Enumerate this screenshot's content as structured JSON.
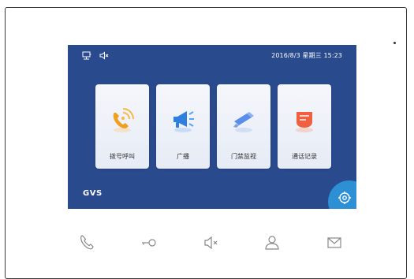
{
  "status": {
    "datetime": "2016/8/3  星期三  15:23",
    "icons": [
      "network-icon",
      "mute-icon"
    ]
  },
  "tiles": [
    {
      "label": "拨号呼叫",
      "icon": "phone-call-icon"
    },
    {
      "label": "广播",
      "icon": "megaphone-icon"
    },
    {
      "label": "门禁监视",
      "icon": "camera-icon"
    },
    {
      "label": "通话记录",
      "icon": "call-log-icon"
    }
  ],
  "brand": "GVS",
  "bottom_buttons": [
    "phone-icon",
    "key-icon",
    "speaker-mute-icon",
    "user-icon",
    "mail-icon"
  ],
  "colors": {
    "screen_bg": "#2a4a8e",
    "settings_bg": "#2d8fd4",
    "phone_orange": "#f0a020",
    "megaphone_blue": "#2f7fe0",
    "camera_blue": "#5a8ee8",
    "log_red": "#f06040"
  }
}
